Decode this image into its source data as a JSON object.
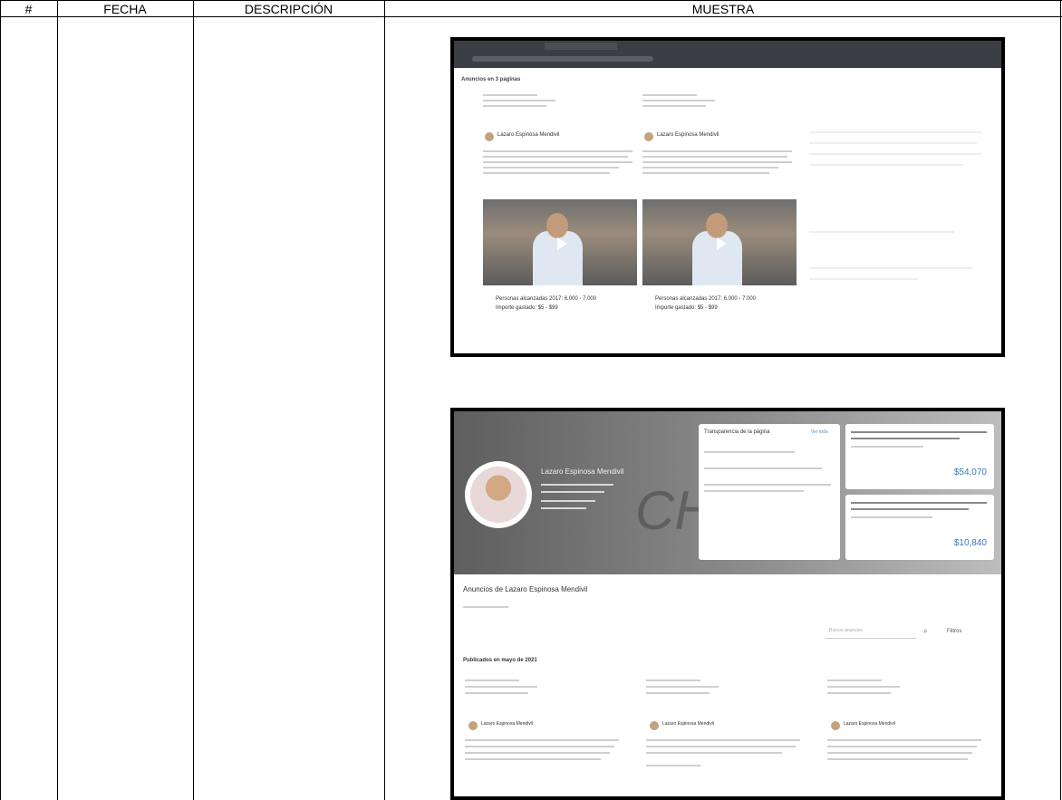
{
  "table": {
    "headers": [
      "#",
      "FECHA",
      "DESCRIPCIÓN",
      "MUESTRA"
    ]
  },
  "sample1": {
    "section_heading": "Anuncios en 3 paginas",
    "card_a": {
      "author": "Lazaro Espinosa Mendivil",
      "stats_line_1": "Personas alcanzadas 2017: 6.000 - 7.000",
      "stats_line_2": "Importe gastado: $5 - $99"
    },
    "card_b": {
      "author": "Lazaro Espinosa Mendivil",
      "stats_line_1": "Personas alcanzadas 2017: 6.000 - 7.000",
      "stats_line_2": "Importe gastado: $5 - $99"
    }
  },
  "sample2": {
    "profile_name": "Lazaro Espinosa Mendivil",
    "panel_title": "Transparencia de la página",
    "panel_link": "Ver todo",
    "spend_box_1_value": "$54,070",
    "spend_box_2_value": "$10,840",
    "ads_title": "Anuncios de Lazaro Espinosa Mendivil",
    "search_placeholder": "Buscar anuncios",
    "filter_label": "Filtros",
    "published_heading": "Publicados en mayo de 2021",
    "card_authors": [
      "Lazaro Espinosa Mendivil",
      "Lazaro Espinosa Mendivil",
      "Lazaro Espinosa Mendivil"
    ]
  }
}
